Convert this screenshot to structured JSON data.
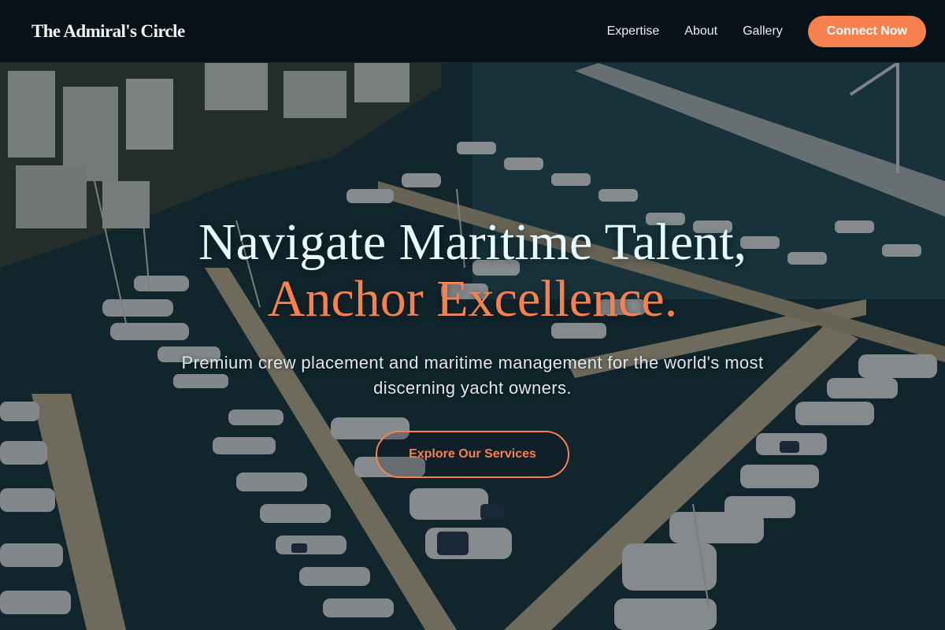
{
  "header": {
    "brand": "The Admiral's Circle",
    "nav": [
      {
        "label": "Expertise"
      },
      {
        "label": "About"
      },
      {
        "label": "Gallery"
      }
    ],
    "cta_label": "Connect Now"
  },
  "hero": {
    "headline_line1": "Navigate Maritime Talent,",
    "headline_line2": "Anchor Excellence.",
    "subheading": "Premium crew placement and maritime management for the world's most discerning yacht owners.",
    "button_label": "Explore Our Services"
  },
  "theme": {
    "accent": "#f6814f",
    "header_bg": "#061118",
    "headline_color": "#e6fbff"
  }
}
